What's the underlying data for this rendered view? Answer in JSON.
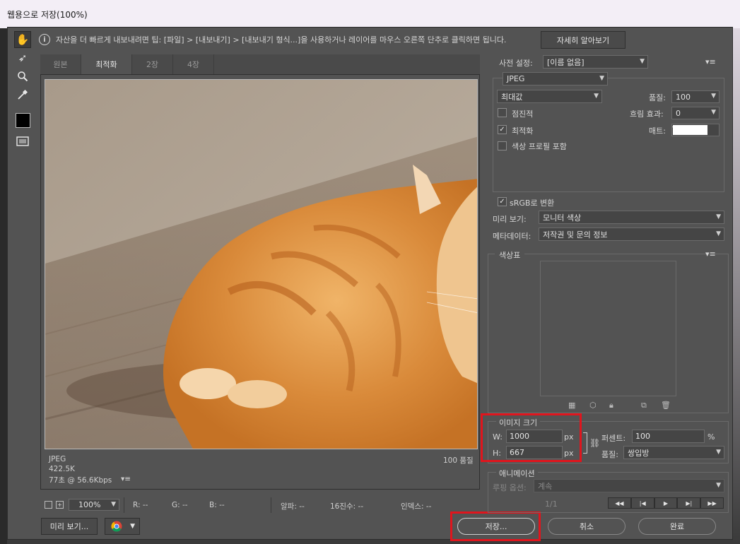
{
  "window": {
    "title": "웹용으로 저장(100%)"
  },
  "tip": {
    "text": "자산을 더 빠르게 내보내려면 팁: [파일] > [내보내기] > [내보내기 형식...]을 사용하거나 레이어를 마우스 오른쪽 단추로 클릭하면 됩니다.",
    "learn_more": "자세히 알아보기"
  },
  "tabs": [
    "원본",
    "최적화",
    "2장",
    "4장"
  ],
  "preview": {
    "format": "JPEG",
    "size": "422.5K",
    "time": "77초 @ 56.6Kbps",
    "quality": "100 품질"
  },
  "status": {
    "zoom": "100%",
    "r": "R: --",
    "g": "G: --",
    "b": "B: --",
    "alpha": "알파: --",
    "hex": "16진수: --",
    "index": "인덱스: --"
  },
  "footer": {
    "preview_btn": "미리 보기...",
    "save": "저장...",
    "cancel": "취소",
    "done": "완료"
  },
  "settings": {
    "preset_label": "사전 설정:",
    "preset_value": "[이름 없음]",
    "format": "JPEG",
    "quality_preset": "최대값",
    "quality_label": "품질:",
    "quality_value": "100",
    "progressive": "점진적",
    "blur_label": "흐림 효과:",
    "blur_value": "0",
    "optimized": "최적화",
    "matte_label": "매트:",
    "icc": "색상 프로필 포함",
    "srgb": "sRGB로 변환",
    "preview_label": "미리 보기:",
    "preview_value": "모니터 색상",
    "metadata_label": "메타데이터:",
    "metadata_value": "저작권 및 문의 정보"
  },
  "color_table": {
    "title": "색상표"
  },
  "image_size": {
    "title": "이미지 크기",
    "w_label": "W:",
    "w_value": "1000",
    "w_unit": "px",
    "h_label": "H:",
    "h_value": "667",
    "h_unit": "px",
    "percent_label": "퍼센트:",
    "percent_value": "100",
    "percent_unit": "%",
    "quality_label": "품질:",
    "quality_value": "쌍입방"
  },
  "animation": {
    "title": "애니메이션",
    "loop_label": "루핑 옵션:",
    "loop_value": "계속",
    "frame": "1/1"
  },
  "colors": {
    "accent_red": "#e0151d",
    "panel": "#535353"
  }
}
